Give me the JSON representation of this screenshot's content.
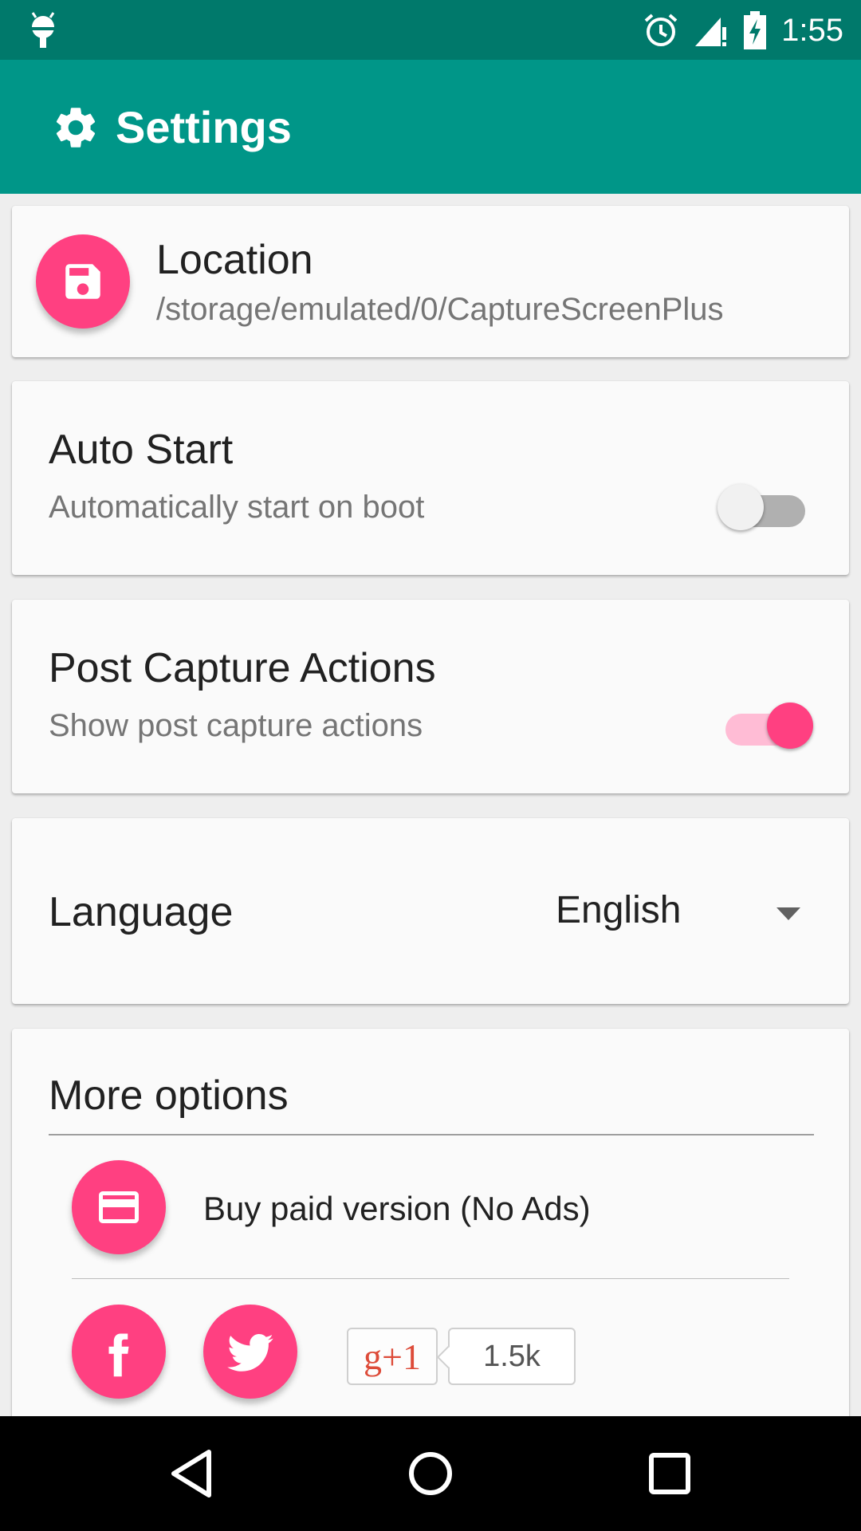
{
  "status_bar": {
    "time": "1:55"
  },
  "app_bar": {
    "title": "Settings"
  },
  "location": {
    "title": "Location",
    "path": "/storage/emulated/0/CaptureScreenPlus"
  },
  "auto_start": {
    "title": "Auto Start",
    "subtitle": "Automatically start on boot",
    "enabled": false
  },
  "post_capture": {
    "title": "Post Capture Actions",
    "subtitle": "Show post capture actions",
    "enabled": true
  },
  "language": {
    "label": "Language",
    "selected": "English"
  },
  "more_options": {
    "title": "More options",
    "buy_label": "Buy paid version (No Ads)",
    "gplus_label": "g+1",
    "gplus_count": "1.5k"
  },
  "colors": {
    "status_bar": "#00796b",
    "app_bar": "#009688",
    "accent": "#ff4081",
    "card": "#fafafa",
    "background": "#eeeeee"
  }
}
